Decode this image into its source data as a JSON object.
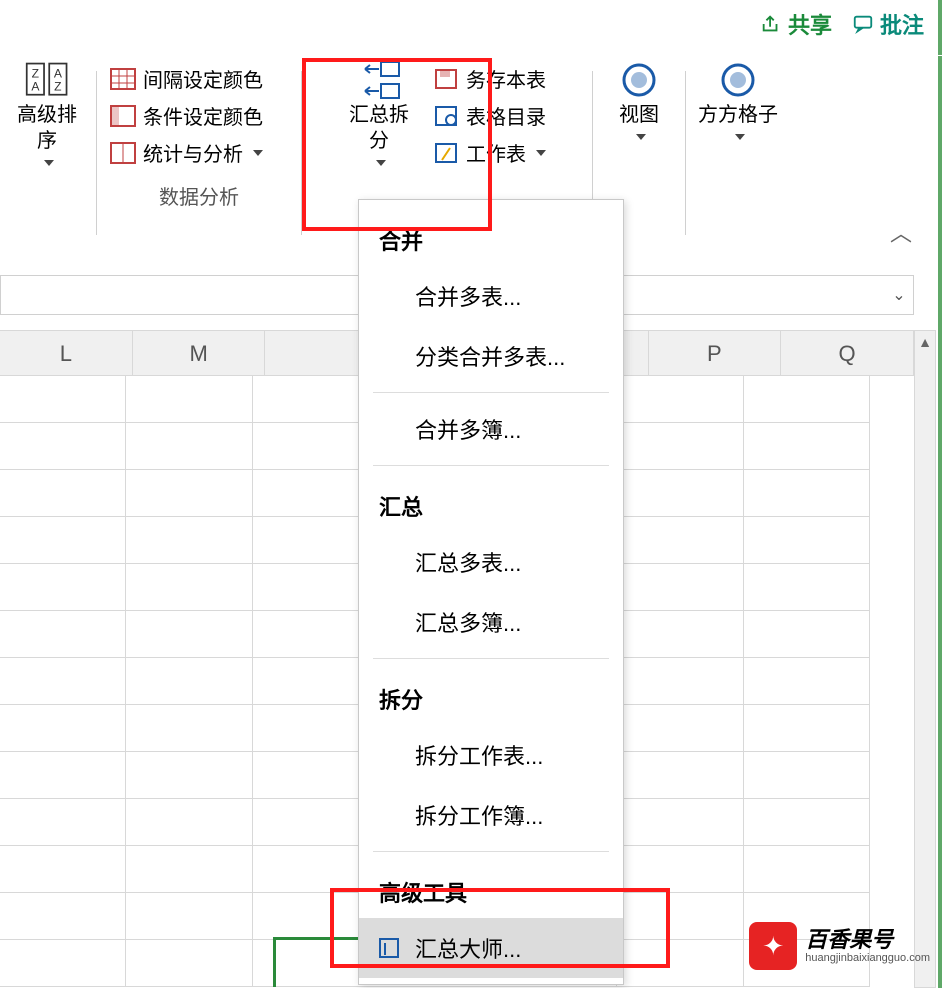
{
  "topbar": {
    "share": "共享",
    "comment": "批注"
  },
  "ribbon": {
    "advSort": "高级排序",
    "rowColor": "间隔设定颜色",
    "condColor": "条件设定颜色",
    "stats": "统计与分析",
    "summarySplit": "汇总拆分",
    "saveTable": "务存本表",
    "tableDir": "表格目录",
    "worksheet": "工作表",
    "view": "视图",
    "ffgz": "方方格子",
    "groupDataAnalysis": "数据分析"
  },
  "menu": {
    "sec1": "合并",
    "mergeTables": "合并多表...",
    "mergeByCat": "分类合并多表...",
    "mergeBooks": "合并多簿...",
    "sec2": "汇总",
    "sumTables": "汇总多表...",
    "sumBooks": "汇总多簿...",
    "sec3": "拆分",
    "splitSheet": "拆分工作表...",
    "splitBook": "拆分工作簿...",
    "sec4": "高级工具",
    "master": "汇总大师..."
  },
  "columns": [
    "L",
    "M",
    "P",
    "Q"
  ],
  "watermark": {
    "title": "百香果号",
    "url": "huangjinbaixiangguo.com"
  }
}
